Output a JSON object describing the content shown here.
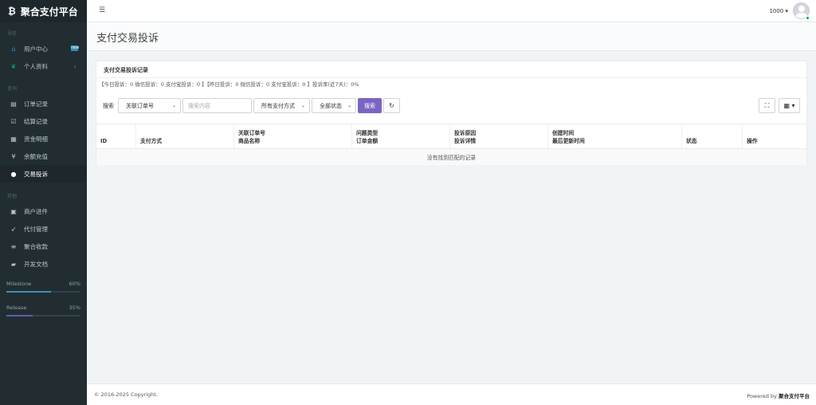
{
  "brand": {
    "logo": "₿",
    "title": "聚合支付平台"
  },
  "sidebar": {
    "sections": [
      {
        "label": "导航",
        "items": [
          {
            "label": "用户中心",
            "icon": "home-icon",
            "glyph": "⌂",
            "color": "#3c8dbc",
            "badge": "new"
          },
          {
            "label": "个人资料",
            "icon": "leaf-icon",
            "glyph": "❦",
            "color": "#00a65a",
            "chevron": "›"
          }
        ]
      },
      {
        "label": "查询",
        "items": [
          {
            "label": "订单记录",
            "icon": "list-icon",
            "glyph": "▤"
          },
          {
            "label": "结算记录",
            "icon": "check-icon",
            "glyph": "☑"
          },
          {
            "label": "资金明细",
            "icon": "table-icon",
            "glyph": "▦"
          },
          {
            "label": "余额充值",
            "icon": "yen-icon",
            "glyph": "¥"
          },
          {
            "label": "交易投诉",
            "icon": "comment-icon",
            "glyph": "●",
            "active": true
          }
        ]
      },
      {
        "label": "其他",
        "items": [
          {
            "label": "商户进件",
            "icon": "file-icon",
            "glyph": "▣"
          },
          {
            "label": "代付管理",
            "icon": "send-icon",
            "glyph": "➶"
          },
          {
            "label": "聚合收款",
            "icon": "bars-icon",
            "glyph": "≡"
          },
          {
            "label": "开发文档",
            "icon": "book-icon",
            "glyph": "▰"
          }
        ]
      }
    ],
    "progress": [
      {
        "label": "Milestone",
        "value": "60%",
        "fraction": 0.6,
        "color": "#3c8dbc"
      },
      {
        "label": "Release",
        "value": "35%",
        "fraction": 0.35,
        "color": "#605ca8"
      }
    ]
  },
  "topbar": {
    "toggle_glyph": "☰",
    "user": "1000 ▾"
  },
  "page": {
    "title": "支付交易投诉"
  },
  "box": {
    "title": "支付交易投诉记录",
    "stats": "【今日投诉：0 微信投诉：0 支付宝投诉：0 】【昨日投诉：0 微信投诉：0 支付宝投诉：0 】投诉率(近7天)：0%"
  },
  "toolbar": {
    "search_label": "搜索",
    "field_select": "关联订单号",
    "search_placeholder": "搜索内容",
    "paytype_select": "所有支付方式",
    "status_select": "全部状态",
    "search_button": "搜索",
    "refresh_glyph": "↻",
    "fullscreen_glyph": "⛶",
    "columns_glyph": "▦ ▾"
  },
  "table": {
    "columns": [
      {
        "l1": "",
        "l2": "ID"
      },
      {
        "l1": "",
        "l2": "支付方式"
      },
      {
        "l1": "关联订单号",
        "l2": "商品名称"
      },
      {
        "l1": "问题类型",
        "l2": "订单金额"
      },
      {
        "l1": "投诉原因",
        "l2": "投诉详情"
      },
      {
        "l1": "创建时间",
        "l2": "最后更新时间"
      },
      {
        "l1": "",
        "l2": "状态"
      },
      {
        "l1": "",
        "l2": "操作"
      }
    ],
    "empty_text": "没有找到匹配的记录"
  },
  "footer": {
    "copyright": "© 2016-2025 Copyright.",
    "powered_prefix": "Powered by ",
    "powered_name": "聚合支付平台"
  }
}
